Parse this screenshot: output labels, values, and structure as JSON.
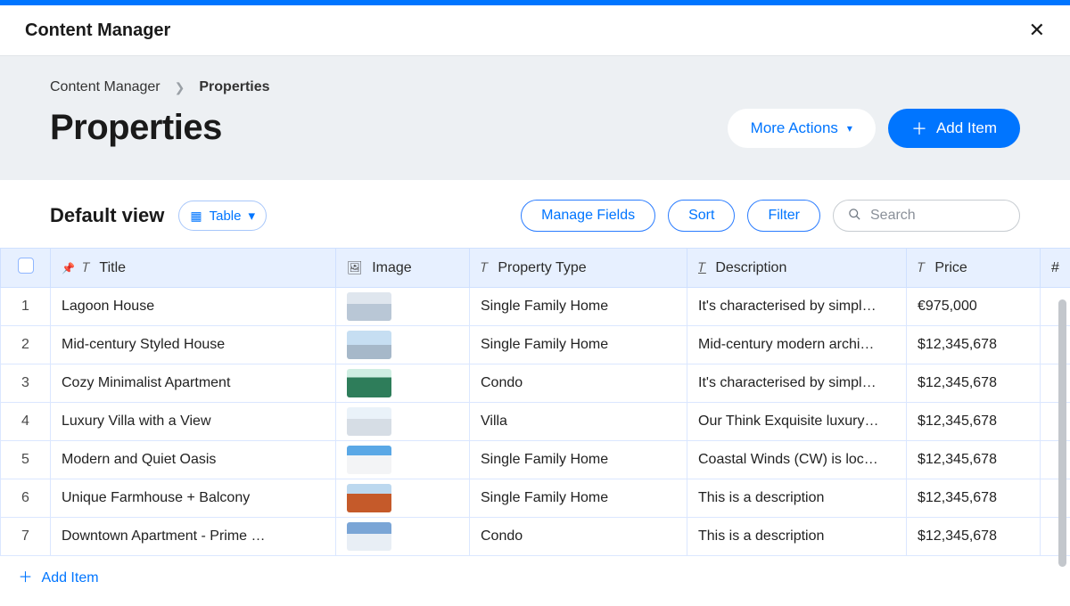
{
  "app_title": "Content Manager",
  "breadcrumb": {
    "root": "Content Manager",
    "current": "Properties"
  },
  "page_title": "Properties",
  "header_actions": {
    "more_label": "More Actions",
    "add_label": "Add Item"
  },
  "toolbar": {
    "view_label": "Default view",
    "view_mode": "Table",
    "manage_fields": "Manage Fields",
    "sort": "Sort",
    "filter": "Filter",
    "search_placeholder": "Search"
  },
  "columns": {
    "title": "Title",
    "image": "Image",
    "property_type": "Property Type",
    "description": "Description",
    "price": "Price",
    "extra": "#"
  },
  "rows": [
    {
      "n": "1",
      "title": "Lagoon House",
      "ptype": "Single Family Home",
      "desc": "It's characterised by simpl…",
      "price": "€975,000"
    },
    {
      "n": "2",
      "title": "Mid-century Styled House",
      "ptype": "Single Family Home",
      "desc": "Mid-century modern archi…",
      "price": "$12,345,678"
    },
    {
      "n": "3",
      "title": "Cozy Minimalist Apartment",
      "ptype": "Condo",
      "desc": "It's characterised by simpl…",
      "price": "$12,345,678"
    },
    {
      "n": "4",
      "title": "Luxury Villa with a View",
      "ptype": "Villa",
      "desc": "Our Think Exquisite luxury…",
      "price": "$12,345,678"
    },
    {
      "n": "5",
      "title": "Modern and Quiet Oasis",
      "ptype": "Single Family Home",
      "desc": "Coastal Winds (CW) is loc…",
      "price": "$12,345,678"
    },
    {
      "n": "6",
      "title": "Unique Farmhouse + Balcony",
      "ptype": "Single Family Home",
      "desc": "This is a description",
      "price": "$12,345,678"
    },
    {
      "n": "7",
      "title": "Downtown Apartment - Prime …",
      "ptype": "Condo",
      "desc": "This is a description",
      "price": "$12,345,678"
    }
  ],
  "footer_add": "Add Item"
}
